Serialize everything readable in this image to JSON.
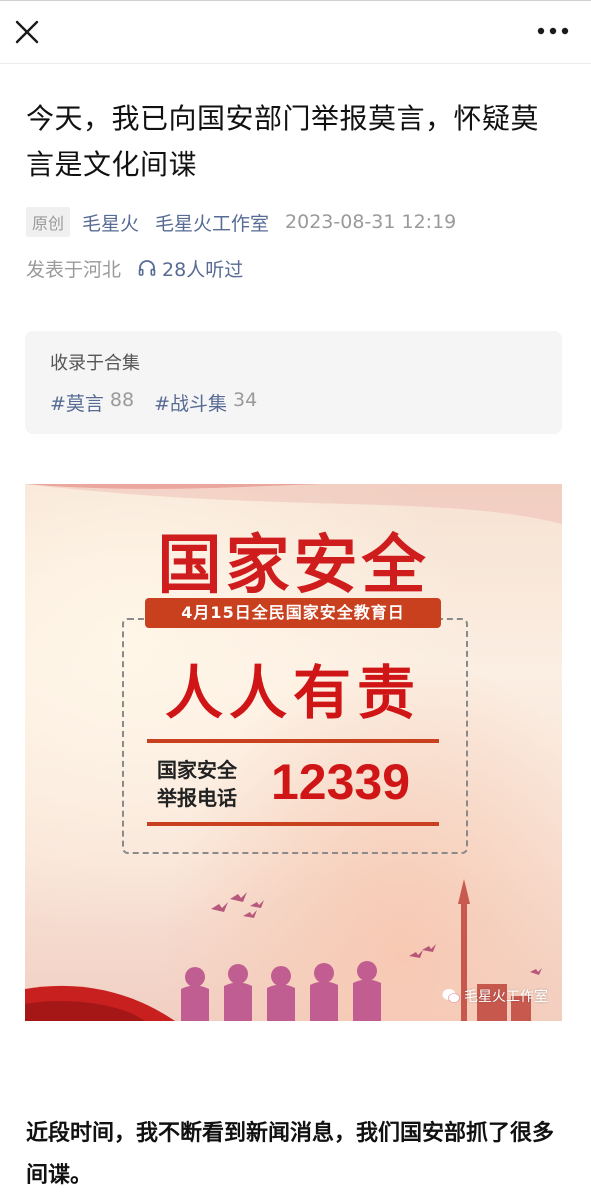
{
  "topbar": {
    "close_icon": "close-icon",
    "more_icon": "more-icon"
  },
  "article": {
    "title": "今天，我已向国安部门举报莫言，怀疑莫言是文化间谍",
    "badge": "原创",
    "author": "毛星火",
    "account": "毛星火工作室",
    "date": "2023-08-31 12:19",
    "location": "发表于河北",
    "listen_count": "28人听过"
  },
  "collection": {
    "label": "收录于合集",
    "tags": [
      {
        "name": "#莫言",
        "count": "88"
      },
      {
        "name": "#战斗集",
        "count": "34"
      }
    ]
  },
  "poster": {
    "title": "国家安全",
    "date_banner": "4月15日全民国家安全教育日",
    "slogan": "人人有责",
    "hotline_label_line1": "国家安全",
    "hotline_label_line2": "举报电话",
    "hotline_number": "12339",
    "watermark": "毛星火工作室",
    "colors": {
      "red": "#cf1515",
      "banner": "#c9401e"
    }
  },
  "body": {
    "paragraph_1": "近段时间，我不断看到新闻消息，我们国安部抓了很多间谍。"
  }
}
